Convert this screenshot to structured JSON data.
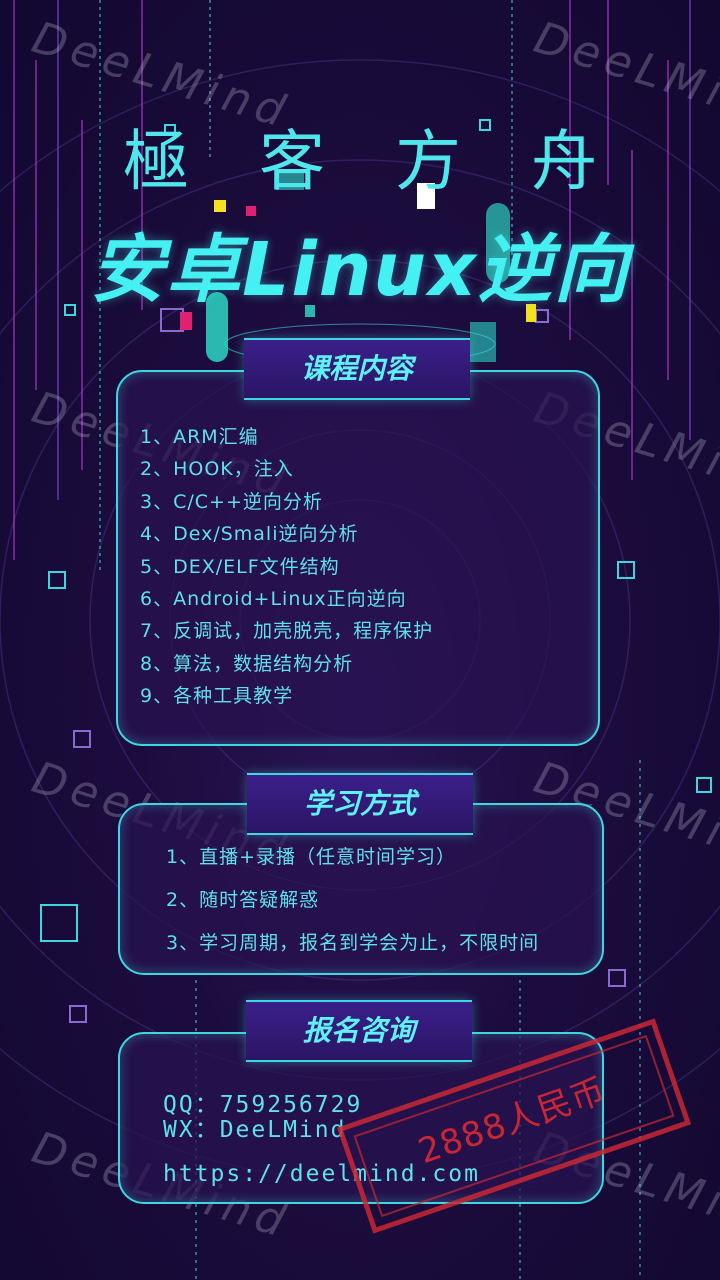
{
  "watermark": "DeeLMind",
  "brand": "極客方舟",
  "headline": "安卓Linux逆向",
  "course": {
    "label": "课程内容",
    "items": [
      "1、ARM汇编",
      "2、HOOK，注入",
      "3、C/C++逆向分析",
      "4、Dex/Smali逆向分析",
      "5、DEX/ELF文件结构",
      "6、Android+Linux正向逆向",
      "7、反调试，加壳脱壳，程序保护",
      "8、算法，数据结构分析",
      "9、各种工具教学"
    ]
  },
  "method": {
    "label": "学习方式",
    "items": [
      "1、直播+录播（任意时间学习）",
      "2、随时答疑解惑",
      "3、学习周期，报名到学会为止，不限时间"
    ]
  },
  "contact": {
    "label": "报名咨询",
    "qq": "QQ：759256729",
    "wx": "WX：DeeLMind",
    "url": "https://deelmind.com"
  },
  "stamp": "2888人民币",
  "colors": {
    "accent": "#3fd7df",
    "background": "#1b0c3d",
    "stamp": "#c82832"
  }
}
